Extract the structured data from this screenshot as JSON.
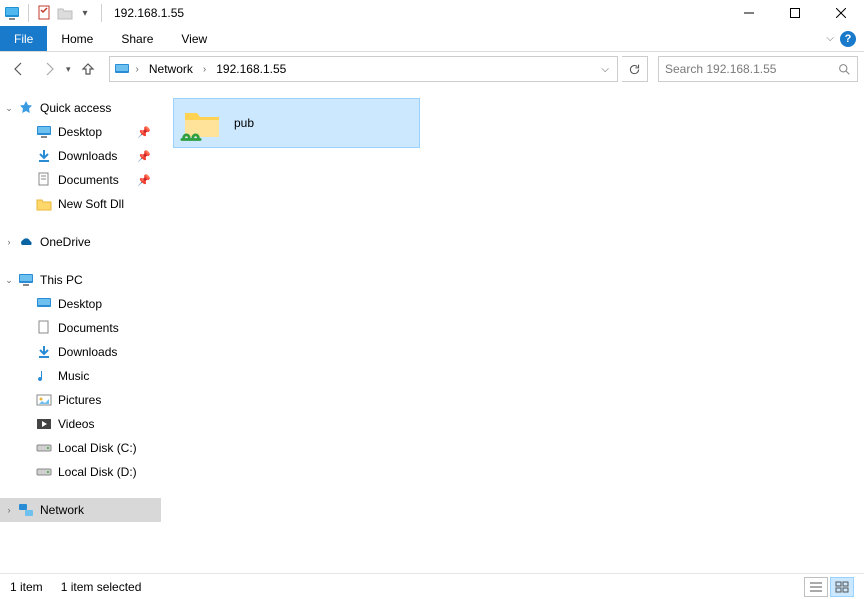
{
  "window": {
    "title": "192.168.1.55"
  },
  "ribbon": {
    "file": "File",
    "tabs": [
      "Home",
      "Share",
      "View"
    ],
    "help": "?"
  },
  "breadcrumb": {
    "segments": [
      "Network",
      "192.168.1.55"
    ]
  },
  "search": {
    "placeholder": "Search 192.168.1.55"
  },
  "tree": {
    "quick_access": {
      "label": "Quick access"
    },
    "qa_children": [
      {
        "label": "Desktop",
        "pinned": true
      },
      {
        "label": "Downloads",
        "pinned": true
      },
      {
        "label": "Documents",
        "pinned": true
      },
      {
        "label": "New Soft Dll",
        "pinned": false
      }
    ],
    "onedrive": {
      "label": "OneDrive"
    },
    "this_pc": {
      "label": "This PC"
    },
    "pc_children": [
      {
        "label": "Desktop"
      },
      {
        "label": "Documents"
      },
      {
        "label": "Downloads"
      },
      {
        "label": "Music"
      },
      {
        "label": "Pictures"
      },
      {
        "label": "Videos"
      },
      {
        "label": "Local Disk (C:)"
      },
      {
        "label": "Local Disk (D:)"
      }
    ],
    "network": {
      "label": "Network"
    }
  },
  "items": [
    {
      "name": "pub"
    }
  ],
  "status": {
    "count": "1 item",
    "selected": "1 item selected"
  }
}
